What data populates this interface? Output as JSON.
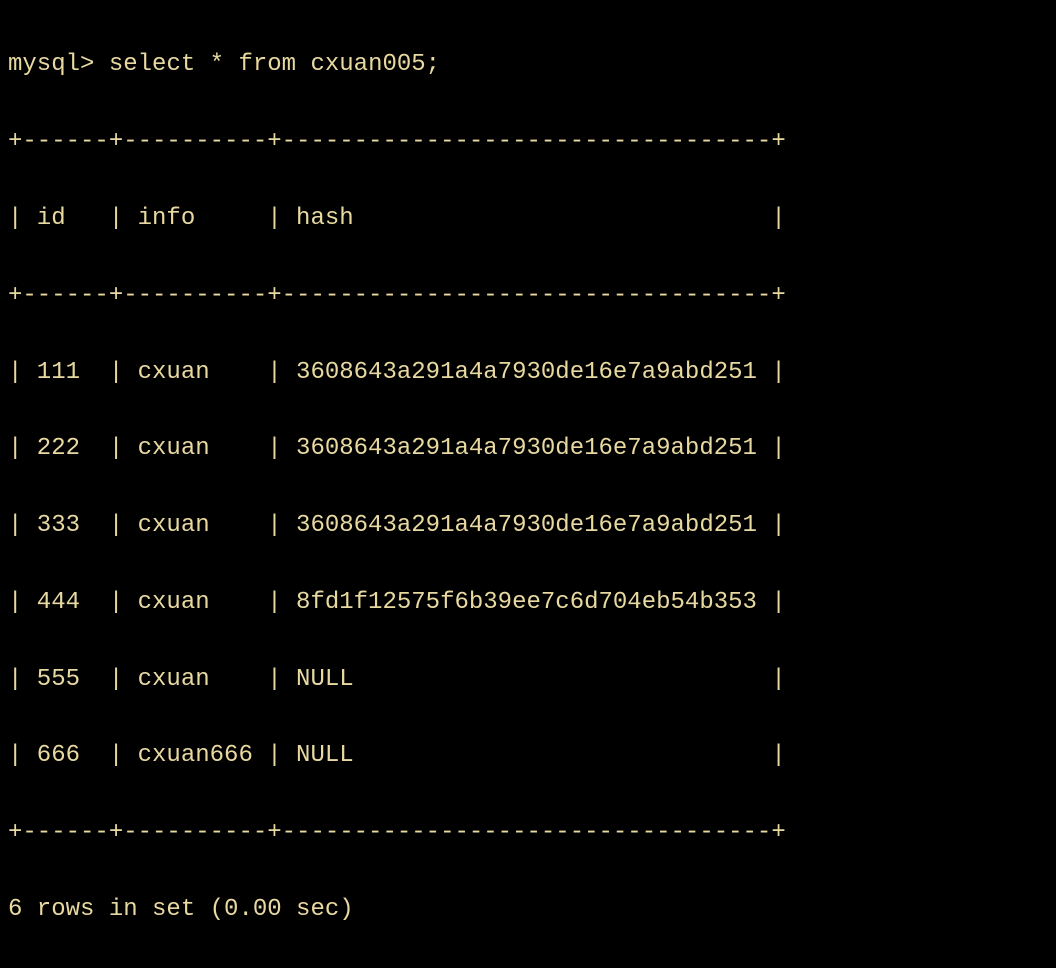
{
  "prompt": "mysql> ",
  "query": "select * from cxuan005;",
  "border_top": "+------+----------+----------------------------------+",
  "header_line": "| id   | info     | hash                             |",
  "border_mid": "+------+----------+----------------------------------+",
  "rows": [
    "| 111  | cxuan    | 3608643a291a4a7930de16e7a9abd251 |",
    "| 222  | cxuan    | 3608643a291a4a7930de16e7a9abd251 |",
    "| 333  | cxuan    | 3608643a291a4a7930de16e7a9abd251 |",
    "| 444  | cxuan    | 8fd1f12575f6b39ee7c6d704eb54b353 |",
    "| 555  | cxuan    | NULL                             |",
    "| 666  | cxuan666 | NULL                             |"
  ],
  "border_bottom": "+------+----------+----------------------------------+",
  "status": "6 rows in set (0.00 sec)",
  "chart_data": {
    "type": "table",
    "columns": [
      "id",
      "info",
      "hash"
    ],
    "data": [
      {
        "id": 111,
        "info": "cxuan",
        "hash": "3608643a291a4a7930de16e7a9abd251"
      },
      {
        "id": 222,
        "info": "cxuan",
        "hash": "3608643a291a4a7930de16e7a9abd251"
      },
      {
        "id": 333,
        "info": "cxuan",
        "hash": "3608643a291a4a7930de16e7a9abd251"
      },
      {
        "id": 444,
        "info": "cxuan",
        "hash": "8fd1f12575f6b39ee7c6d704eb54b353"
      },
      {
        "id": 555,
        "info": "cxuan",
        "hash": null
      },
      {
        "id": 666,
        "info": "cxuan666",
        "hash": null
      }
    ],
    "row_count": 6,
    "elapsed_sec": 0.0
  }
}
